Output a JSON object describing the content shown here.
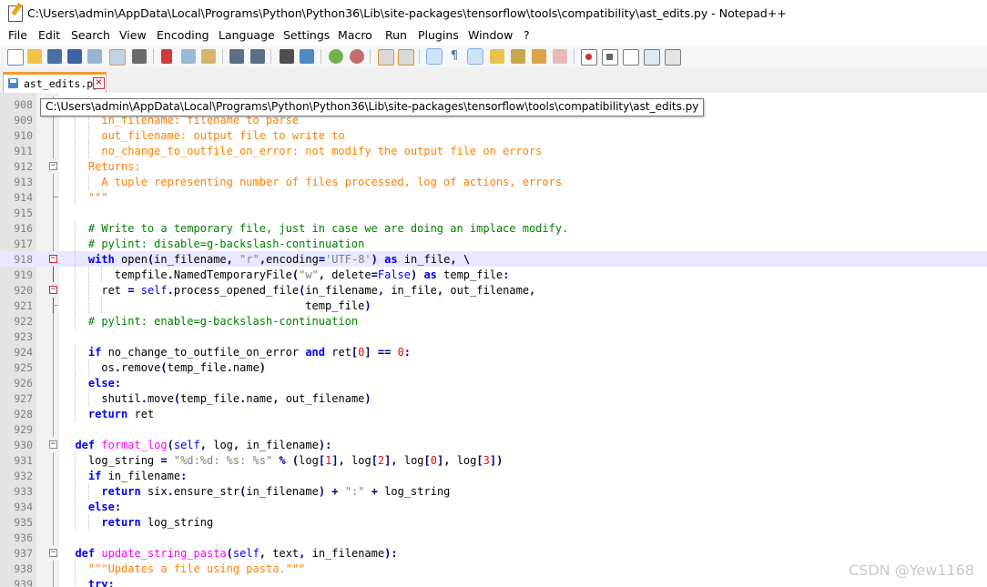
{
  "window": {
    "title": "C:\\Users\\admin\\AppData\\Local\\Programs\\Python\\Python36\\Lib\\site-packages\\tensorflow\\tools\\compatibility\\ast_edits.py - Notepad++"
  },
  "menu": [
    "File",
    "Edit",
    "Search",
    "View",
    "Encoding",
    "Language",
    "Settings",
    "Macro",
    "Run",
    "Plugins",
    "Window",
    "?"
  ],
  "tab": {
    "label": "ast_edits.py",
    "close": "×"
  },
  "tooltip": "C:\\Users\\admin\\AppData\\Local\\Programs\\Python\\Python36\\Lib\\site-packages\\tensorflow\\tools\\compatibility\\ast_edits.py",
  "watermark": "CSDN @Yew1168",
  "colors": {
    "accent_tab": "#f39a2d",
    "keyword": "#0000ff",
    "docstring": "#ff8000",
    "comment": "#008000",
    "number": "#ff0000",
    "function_name": "#ff00ff",
    "string": "#808080",
    "current_line": "#e8e8ff"
  },
  "lines": [
    {
      "n": "908",
      "text": "      in_filename: filename to parse"
    },
    {
      "n": "909",
      "text": "      in_filename: filename to parse"
    },
    {
      "n": "910",
      "text": "      out_filename: output file to write to"
    },
    {
      "n": "911",
      "text": "      no_change_to_outfile_on_error: not modify the output file on errors"
    },
    {
      "n": "912",
      "text": "    Returns:"
    },
    {
      "n": "913",
      "text": "      A tuple representing number of files processed, log of actions, errors"
    },
    {
      "n": "914",
      "text": "    \"\"\""
    },
    {
      "n": "915",
      "text": ""
    },
    {
      "n": "916",
      "text": "    # Write to a temporary file, just in case we are doing an implace modify."
    },
    {
      "n": "917",
      "text": "    # pylint: disable=g-backslash-continuation"
    },
    {
      "n": "918",
      "text": "    with open(in_filename, \"r\",encoding='UTF-8') as in_file, \\"
    },
    {
      "n": "919",
      "text": "        tempfile.NamedTemporaryFile(\"w\", delete=False) as temp_file:"
    },
    {
      "n": "920",
      "text": "      ret = self.process_opened_file(in_filename, in_file, out_filename,"
    },
    {
      "n": "921",
      "text": "                                     temp_file)"
    },
    {
      "n": "922",
      "text": "    # pylint: enable=g-backslash-continuation"
    },
    {
      "n": "923",
      "text": ""
    },
    {
      "n": "924",
      "text": "    if no_change_to_outfile_on_error and ret[0] == 0:"
    },
    {
      "n": "925",
      "text": "      os.remove(temp_file.name)"
    },
    {
      "n": "926",
      "text": "    else:"
    },
    {
      "n": "927",
      "text": "      shutil.move(temp_file.name, out_filename)"
    },
    {
      "n": "928",
      "text": "    return ret"
    },
    {
      "n": "929",
      "text": ""
    },
    {
      "n": "930",
      "text": "  def format_log(self, log, in_filename):"
    },
    {
      "n": "931",
      "text": "    log_string = \"%d:%d: %s: %s\" % (log[1], log[2], log[0], log[3])"
    },
    {
      "n": "932",
      "text": "    if in_filename:"
    },
    {
      "n": "933",
      "text": "      return six.ensure_str(in_filename) + \":\" + log_string"
    },
    {
      "n": "934",
      "text": "    else:"
    },
    {
      "n": "935",
      "text": "      return log_string"
    },
    {
      "n": "936",
      "text": ""
    },
    {
      "n": "937",
      "text": "  def update_string_pasta(self, text, in_filename):"
    },
    {
      "n": "938",
      "text": "    \"\"\"Updates a file using pasta.\"\"\""
    },
    {
      "n": "939",
      "text": "    try:"
    }
  ]
}
